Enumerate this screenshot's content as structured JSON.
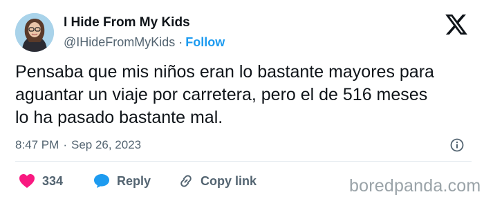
{
  "author": {
    "name": "I Hide From My Kids",
    "handle": "@IHideFromMyKids",
    "separator": "·",
    "follow_label": "Follow"
  },
  "tweet": {
    "text": "Pensaba que mis niños eran lo bastante mayores para\naguantar un viaje por carretera, pero el de 516 meses\nlo ha pasado bastante mal.",
    "time": "8:47 PM",
    "separator": "·",
    "date": "Sep 26, 2023"
  },
  "actions": {
    "like_count": "334",
    "reply_label": "Reply",
    "copy_label": "Copy link"
  },
  "watermark": "boredpanda.com",
  "colors": {
    "accent": "#1d9bf0",
    "like": "#f91880",
    "text": "#0f1419",
    "muted": "#536471"
  },
  "icons": [
    "x-logo-icon",
    "info-icon",
    "heart-icon",
    "reply-bubble-icon",
    "link-icon"
  ]
}
